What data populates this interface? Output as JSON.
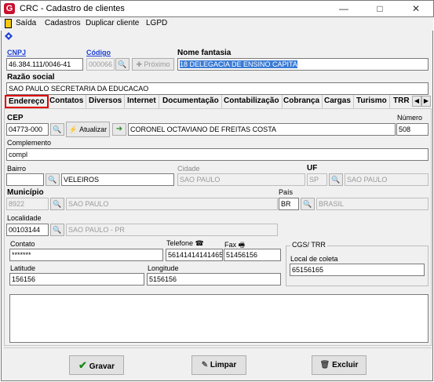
{
  "window": {
    "title": "CRC - Cadastro de clientes",
    "minimize": "—",
    "maximize": "□",
    "close": "✕",
    "logo": "G"
  },
  "menu": [
    "Saída",
    "Cadastros",
    "Duplicar cliente",
    "LGPD"
  ],
  "header": {
    "cnpj_label": "CNPJ",
    "cnpj_value": "46.384.111/0046-41",
    "codigo_label": "Código",
    "codigo_value": "000066",
    "proximo_label": "Próximo",
    "fantasia_label": "Nome fantasia",
    "fantasia_value": "18 DELEGACIA DE ENSINO CAPITA",
    "razao_label": "Razão social",
    "razao_value": "SAO PAULO SECRETARIA DA EDUCACAO"
  },
  "tabs": [
    "Endereço",
    "Contatos",
    "Diversos",
    "Internet",
    "Documentação",
    "Contabilização",
    "Cobrança",
    "Cargas",
    "Turismo",
    "TRR"
  ],
  "form": {
    "cep_label": "CEP",
    "cep_value": "04773-000",
    "atualizar_label": "Atualizar",
    "street_value": "CORONEL OCTAVIANO DE FREITAS COSTA",
    "numero_label": "Número",
    "numero_value": "508",
    "complemento_label": "Complemento",
    "complemento_value": "compl",
    "bairro_label": "Bairro",
    "bairro_code": "",
    "bairro_value": "VELEIROS",
    "cidade_label": "Cidade",
    "cidade_value": "SAO PAULO",
    "uf_label": "UF",
    "uf_value": "SP",
    "uf_name": "SAO PAULO",
    "municipio_label": "Município",
    "municipio_code": "8922",
    "municipio_value": "SAO PAULO",
    "pais_label": "País",
    "pais_code": "BR",
    "pais_value": "BRASIL",
    "localidade_label": "Localidade",
    "localidade_code": "00103144",
    "localidade_value": "SAO PAULO - PR",
    "contato_label": "Contato",
    "contato_value": "*******",
    "telefone_label": "Telefone",
    "telefone_value": "56141414141465",
    "fax_label": "Fax",
    "fax_value": "51456156",
    "latitude_label": "Latitude",
    "latitude_value": "156156",
    "longitude_label": "Longitude",
    "longitude_value": "5156156",
    "cgs_label": "CGS/ TRR",
    "coleta_label": "Local de coleta",
    "coleta_value": "65156165",
    "obs_value": ""
  },
  "buttons": {
    "gravar": "Gravar",
    "limpar": "Limpar",
    "excluir": "Excluir"
  },
  "colors": {
    "selected_tab_border": "#e00000",
    "link_blue": "#1a3fd6",
    "selection": "#3a7bd5"
  }
}
